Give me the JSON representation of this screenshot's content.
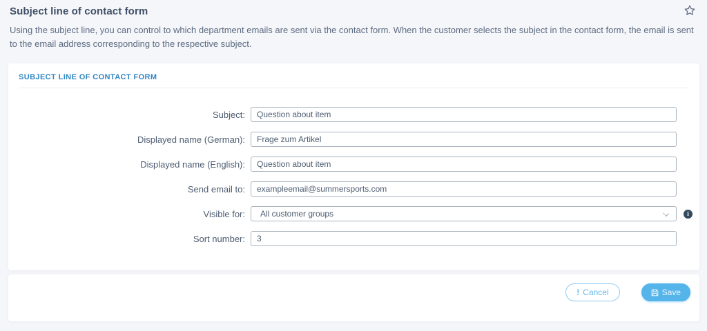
{
  "page": {
    "title": "Subject line of contact form",
    "description": "Using the subject line, you can control to which department emails are sent via the contact form. When the customer selects the subject in the contact form, the email is sent to the email address corresponding to the respective subject."
  },
  "header_icons": {
    "favorite_star": "star-outline"
  },
  "form": {
    "section_title": "SUBJECT LINE OF CONTACT FORM",
    "fields": [
      {
        "label": "Subject:",
        "value": "Question about item",
        "type": "text"
      },
      {
        "label": "Displayed name (German):",
        "value": "Frage zum Artikel",
        "type": "text"
      },
      {
        "label": "Displayed name (English):",
        "value": "Question about item",
        "type": "text"
      },
      {
        "label": "Send email to:",
        "value": "exampleemail@summersports.com",
        "type": "text"
      },
      {
        "label": "Visible for:",
        "value": "All customer groups",
        "type": "select",
        "has_info": true,
        "info_glyph": "i"
      },
      {
        "label": "Sort number:",
        "value": "3",
        "type": "text"
      }
    ]
  },
  "footer": {
    "cancel_label": "Cancel",
    "cancel_icon_glyph": "!",
    "save_label": "Save",
    "save_icon": "floppy-disk"
  },
  "colors": {
    "page_background": "#f5f6fa",
    "card_background": "#ffffff",
    "section_title_blue": "#3286c3",
    "primary_button_blue": "#55b4ea",
    "outline_button_blue": "#64b8ec",
    "text_slate": "#4d5c70",
    "info_icon_navy": "#33495d",
    "input_border": "#a8b3be"
  }
}
